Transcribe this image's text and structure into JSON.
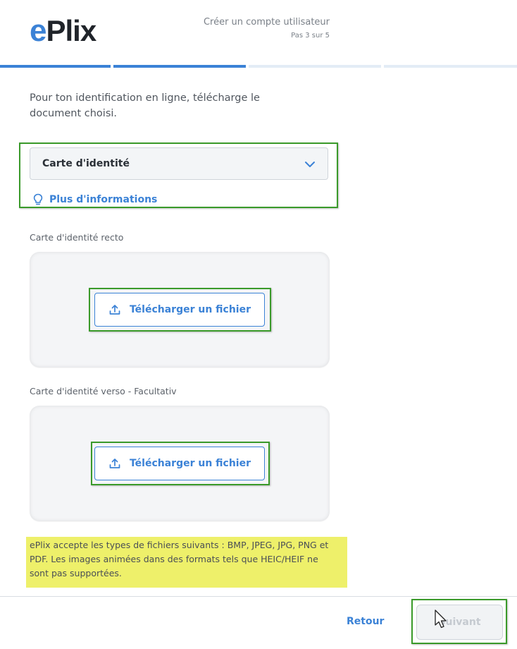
{
  "header": {
    "logo_e": "e",
    "logo_rest": "Plix",
    "title": "Créer un compte utilisateur",
    "step": "Pas 3 sur 5",
    "progress": {
      "current_step": 3,
      "total_steps": 5,
      "completed_segments": 2
    }
  },
  "main": {
    "intro": "Pour ton identification en ligne, télécharge le document choisi.",
    "document_select": {
      "value": "Carte d'identité"
    },
    "more_info_label": "Plus d'informations",
    "front": {
      "label": "Carte d'identité recto",
      "upload_label": "Télécharger un fichier"
    },
    "back": {
      "label": "Carte d'identité verso - Facultativ",
      "upload_label": "Télécharger un fichier"
    },
    "note": "ePlix accepte les types de fichiers suivants : BMP, JPEG, JPG, PNG et PDF. Les images animées dans des formats tels que HEIC/HEIF ne sont pas supportées."
  },
  "footer": {
    "back_label": "Retour",
    "next_label": "Suivant"
  },
  "colors": {
    "accent": "#3b82d6",
    "highlight_box": "#3a9a2a",
    "highlight_yellow": "#eef06a"
  }
}
